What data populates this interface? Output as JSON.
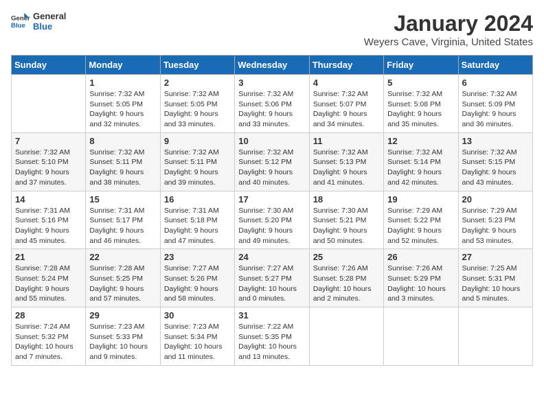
{
  "logo": {
    "text_general": "General",
    "text_blue": "Blue"
  },
  "title": "January 2024",
  "subtitle": "Weyers Cave, Virginia, United States",
  "weekdays": [
    "Sunday",
    "Monday",
    "Tuesday",
    "Wednesday",
    "Thursday",
    "Friday",
    "Saturday"
  ],
  "weeks": [
    [
      {
        "day": "",
        "sunrise": "",
        "sunset": "",
        "daylight": ""
      },
      {
        "day": "1",
        "sunrise": "Sunrise: 7:32 AM",
        "sunset": "Sunset: 5:05 PM",
        "daylight": "Daylight: 9 hours and 32 minutes."
      },
      {
        "day": "2",
        "sunrise": "Sunrise: 7:32 AM",
        "sunset": "Sunset: 5:05 PM",
        "daylight": "Daylight: 9 hours and 33 minutes."
      },
      {
        "day": "3",
        "sunrise": "Sunrise: 7:32 AM",
        "sunset": "Sunset: 5:06 PM",
        "daylight": "Daylight: 9 hours and 33 minutes."
      },
      {
        "day": "4",
        "sunrise": "Sunrise: 7:32 AM",
        "sunset": "Sunset: 5:07 PM",
        "daylight": "Daylight: 9 hours and 34 minutes."
      },
      {
        "day": "5",
        "sunrise": "Sunrise: 7:32 AM",
        "sunset": "Sunset: 5:08 PM",
        "daylight": "Daylight: 9 hours and 35 minutes."
      },
      {
        "day": "6",
        "sunrise": "Sunrise: 7:32 AM",
        "sunset": "Sunset: 5:09 PM",
        "daylight": "Daylight: 9 hours and 36 minutes."
      }
    ],
    [
      {
        "day": "7",
        "sunrise": "Sunrise: 7:32 AM",
        "sunset": "Sunset: 5:10 PM",
        "daylight": "Daylight: 9 hours and 37 minutes."
      },
      {
        "day": "8",
        "sunrise": "Sunrise: 7:32 AM",
        "sunset": "Sunset: 5:11 PM",
        "daylight": "Daylight: 9 hours and 38 minutes."
      },
      {
        "day": "9",
        "sunrise": "Sunrise: 7:32 AM",
        "sunset": "Sunset: 5:11 PM",
        "daylight": "Daylight: 9 hours and 39 minutes."
      },
      {
        "day": "10",
        "sunrise": "Sunrise: 7:32 AM",
        "sunset": "Sunset: 5:12 PM",
        "daylight": "Daylight: 9 hours and 40 minutes."
      },
      {
        "day": "11",
        "sunrise": "Sunrise: 7:32 AM",
        "sunset": "Sunset: 5:13 PM",
        "daylight": "Daylight: 9 hours and 41 minutes."
      },
      {
        "day": "12",
        "sunrise": "Sunrise: 7:32 AM",
        "sunset": "Sunset: 5:14 PM",
        "daylight": "Daylight: 9 hours and 42 minutes."
      },
      {
        "day": "13",
        "sunrise": "Sunrise: 7:32 AM",
        "sunset": "Sunset: 5:15 PM",
        "daylight": "Daylight: 9 hours and 43 minutes."
      }
    ],
    [
      {
        "day": "14",
        "sunrise": "Sunrise: 7:31 AM",
        "sunset": "Sunset: 5:16 PM",
        "daylight": "Daylight: 9 hours and 45 minutes."
      },
      {
        "day": "15",
        "sunrise": "Sunrise: 7:31 AM",
        "sunset": "Sunset: 5:17 PM",
        "daylight": "Daylight: 9 hours and 46 minutes."
      },
      {
        "day": "16",
        "sunrise": "Sunrise: 7:31 AM",
        "sunset": "Sunset: 5:18 PM",
        "daylight": "Daylight: 9 hours and 47 minutes."
      },
      {
        "day": "17",
        "sunrise": "Sunrise: 7:30 AM",
        "sunset": "Sunset: 5:20 PM",
        "daylight": "Daylight: 9 hours and 49 minutes."
      },
      {
        "day": "18",
        "sunrise": "Sunrise: 7:30 AM",
        "sunset": "Sunset: 5:21 PM",
        "daylight": "Daylight: 9 hours and 50 minutes."
      },
      {
        "day": "19",
        "sunrise": "Sunrise: 7:29 AM",
        "sunset": "Sunset: 5:22 PM",
        "daylight": "Daylight: 9 hours and 52 minutes."
      },
      {
        "day": "20",
        "sunrise": "Sunrise: 7:29 AM",
        "sunset": "Sunset: 5:23 PM",
        "daylight": "Daylight: 9 hours and 53 minutes."
      }
    ],
    [
      {
        "day": "21",
        "sunrise": "Sunrise: 7:28 AM",
        "sunset": "Sunset: 5:24 PM",
        "daylight": "Daylight: 9 hours and 55 minutes."
      },
      {
        "day": "22",
        "sunrise": "Sunrise: 7:28 AM",
        "sunset": "Sunset: 5:25 PM",
        "daylight": "Daylight: 9 hours and 57 minutes."
      },
      {
        "day": "23",
        "sunrise": "Sunrise: 7:27 AM",
        "sunset": "Sunset: 5:26 PM",
        "daylight": "Daylight: 9 hours and 58 minutes."
      },
      {
        "day": "24",
        "sunrise": "Sunrise: 7:27 AM",
        "sunset": "Sunset: 5:27 PM",
        "daylight": "Daylight: 10 hours and 0 minutes."
      },
      {
        "day": "25",
        "sunrise": "Sunrise: 7:26 AM",
        "sunset": "Sunset: 5:28 PM",
        "daylight": "Daylight: 10 hours and 2 minutes."
      },
      {
        "day": "26",
        "sunrise": "Sunrise: 7:26 AM",
        "sunset": "Sunset: 5:29 PM",
        "daylight": "Daylight: 10 hours and 3 minutes."
      },
      {
        "day": "27",
        "sunrise": "Sunrise: 7:25 AM",
        "sunset": "Sunset: 5:31 PM",
        "daylight": "Daylight: 10 hours and 5 minutes."
      }
    ],
    [
      {
        "day": "28",
        "sunrise": "Sunrise: 7:24 AM",
        "sunset": "Sunset: 5:32 PM",
        "daylight": "Daylight: 10 hours and 7 minutes."
      },
      {
        "day": "29",
        "sunrise": "Sunrise: 7:23 AM",
        "sunset": "Sunset: 5:33 PM",
        "daylight": "Daylight: 10 hours and 9 minutes."
      },
      {
        "day": "30",
        "sunrise": "Sunrise: 7:23 AM",
        "sunset": "Sunset: 5:34 PM",
        "daylight": "Daylight: 10 hours and 11 minutes."
      },
      {
        "day": "31",
        "sunrise": "Sunrise: 7:22 AM",
        "sunset": "Sunset: 5:35 PM",
        "daylight": "Daylight: 10 hours and 13 minutes."
      },
      {
        "day": "",
        "sunrise": "",
        "sunset": "",
        "daylight": ""
      },
      {
        "day": "",
        "sunrise": "",
        "sunset": "",
        "daylight": ""
      },
      {
        "day": "",
        "sunrise": "",
        "sunset": "",
        "daylight": ""
      }
    ]
  ]
}
